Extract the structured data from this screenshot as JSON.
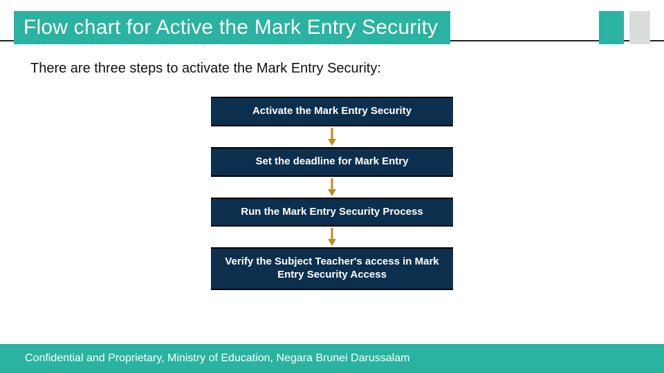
{
  "title": "Flow chart for Active the Mark Entry Security",
  "subtitle": "There are three steps to activate the Mark Entry Security:",
  "steps": [
    "Activate the Mark Entry Security",
    "Set the deadline for Mark Entry",
    "Run the Mark Entry Security Process",
    "Verify the Subject Teacher's access in Mark Entry Security Access"
  ],
  "footer": "Confidential and Proprietary, Ministry of Education, Negara Brunei Darussalam",
  "colors": {
    "accent": "#2ab3a0",
    "step_bg": "#0c2f4e",
    "arrow": "#c38a1f"
  }
}
